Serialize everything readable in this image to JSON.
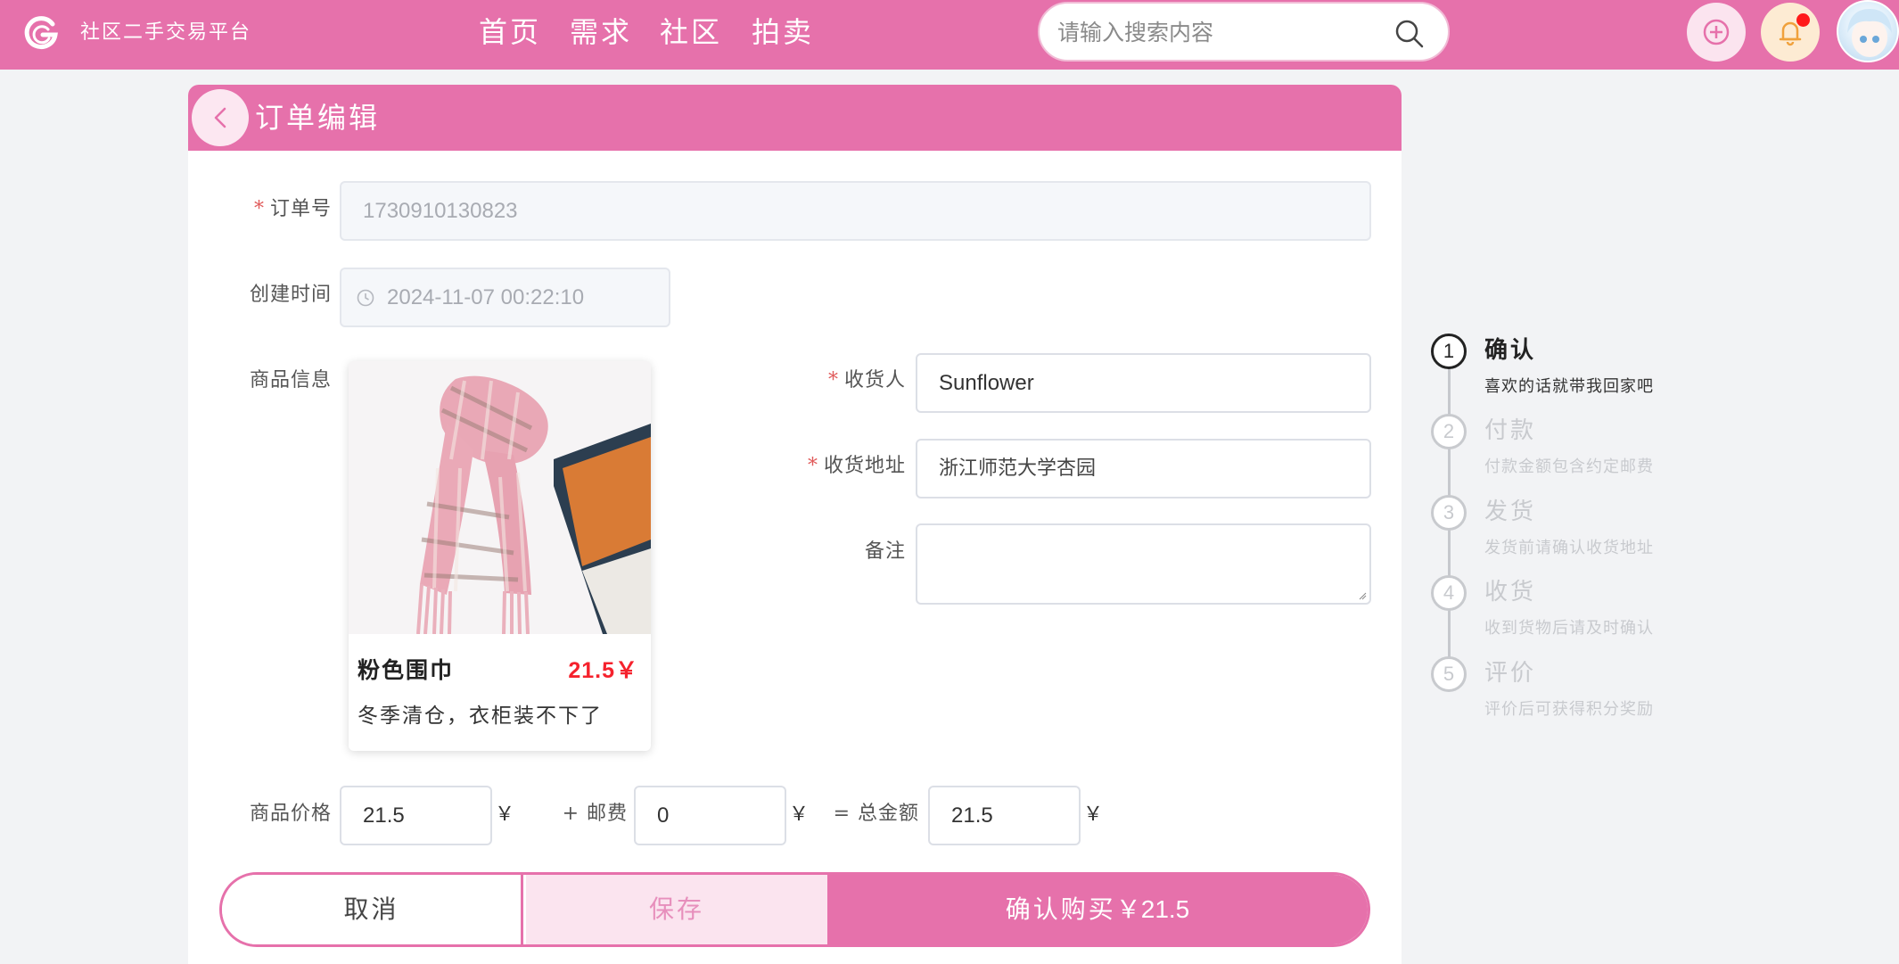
{
  "header": {
    "brand": "社区二手交易平台",
    "nav": [
      "首页",
      "需求",
      "社区",
      "拍卖"
    ],
    "search_placeholder": "请输入搜索内容"
  },
  "page": {
    "title": "订单编辑"
  },
  "form": {
    "order_no_label": "订单号",
    "order_no_value": "1730910130823",
    "created_label": "创建时间",
    "created_value": "2024-11-07 00:22:10",
    "product_label": "商品信息",
    "receiver_label": "收货人",
    "receiver_value": "Sunflower",
    "address_label": "收货地址",
    "address_value": "浙江师范大学杏园",
    "remark_label": "备注",
    "remark_value": "",
    "price_label": "商品价格",
    "price_value": "21.5",
    "shipping_label": "+ 邮费",
    "shipping_value": "0",
    "total_label": "= 总金额",
    "total_value": "21.5",
    "currency": "￥",
    "required_mark": "*"
  },
  "product": {
    "name": "粉色围巾",
    "price": "21.5￥",
    "description": "冬季清仓，衣柜装不下了"
  },
  "actions": {
    "cancel": "取消",
    "save": "保存",
    "confirm": "确认购买",
    "confirm_amount": "￥21.5"
  },
  "steps": [
    {
      "num": "1",
      "title": "确认",
      "desc": "喜欢的话就带我回家吧",
      "active": true
    },
    {
      "num": "2",
      "title": "付款",
      "desc": "付款金额包含约定邮费",
      "active": false
    },
    {
      "num": "3",
      "title": "发货",
      "desc": "发货前请确认收货地址",
      "active": false
    },
    {
      "num": "4",
      "title": "收货",
      "desc": "收到货物后请及时确认",
      "active": false
    },
    {
      "num": "5",
      "title": "评价",
      "desc": "评价后可获得积分奖励",
      "active": false
    }
  ],
  "colors": {
    "primary": "#e671ab",
    "primary_light": "#fbe4ef",
    "price_red": "#f5222d",
    "required_red": "#e05a5a"
  },
  "icons": {
    "logo": "g-logo-icon",
    "search": "search-icon",
    "add": "plus-circle-icon",
    "bell": "bell-icon",
    "back": "chevron-left-icon",
    "clock": "clock-icon"
  }
}
